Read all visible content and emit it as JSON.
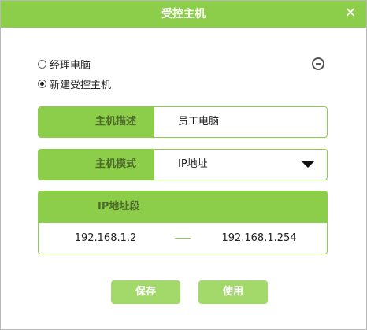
{
  "dialog": {
    "title": "受控主机",
    "close_glyph": "✕"
  },
  "radio_options": [
    {
      "label": "经理电脑",
      "checked": false
    },
    {
      "label": "新建受控主机",
      "checked": true
    }
  ],
  "host_description": {
    "label": "主机描述",
    "value": "员工电脑"
  },
  "host_mode": {
    "label": "主机模式",
    "value": "IP地址"
  },
  "ip_range": {
    "label": "IP地址段",
    "start": "192.168.1.2",
    "end": "192.168.1.254"
  },
  "buttons": {
    "save": "保存",
    "use": "使用"
  },
  "colors": {
    "accent": "#8ccd4a",
    "button": "#a3d86b",
    "label_text": "#4d6b2a"
  },
  "icons": {
    "close": "close-icon",
    "remove": "minus-circle-icon",
    "dropdown": "dropdown-arrow-icon"
  }
}
